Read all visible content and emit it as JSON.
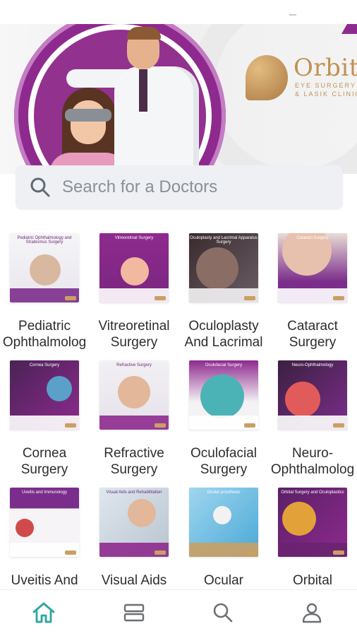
{
  "app": {
    "banner": {
      "logo_name": "Orbit",
      "logo_sub1": "EYE SURGERY",
      "logo_sub2": "& LASIK CLINICS"
    },
    "search": {
      "placeholder": "Search for a Doctors",
      "icon": "search-icon"
    },
    "specialties": [
      {
        "label": "Pediatric\nOphthalmolog",
        "thumb_title": "Pediatric Ophthalmology and Strabismus Surgery",
        "accent": "#7b2d8b"
      },
      {
        "label": "Vitreoretinal\nSurgery",
        "thumb_title": "Vitreoretinal Surgery",
        "accent": "#8e2a8e"
      },
      {
        "label": "Oculoplasty\nAnd Lacrimal",
        "thumb_title": "Oculoplasty and Lacrimal Apparatus Surgery",
        "accent": "#6a2470"
      },
      {
        "label": "Cataract\nSurgery",
        "thumb_title": "Cataract Surgery",
        "accent": "#7b2d8b"
      },
      {
        "label": "Cornea\nSurgery",
        "thumb_title": "Cornea Surgery",
        "accent": "#6b2a7a"
      },
      {
        "label": "Refractive\nSurgery",
        "thumb_title": "Refractive Surgery",
        "accent": "#8e2a8e"
      },
      {
        "label": "Oculofacial\nSurgery",
        "thumb_title": "Oculofacial Surgery",
        "accent": "#7b2d8b"
      },
      {
        "label": "Neuro-\nOphthalmolog",
        "thumb_title": "Neuro-Ophthalmology",
        "accent": "#6a2470"
      },
      {
        "label": "Uveitis And",
        "thumb_title": "Uveitis and Immunology",
        "accent": "#7b2d8b"
      },
      {
        "label": "Visual Aids",
        "thumb_title": "Visual Aids and Rehabilitation",
        "accent": "#8e2a8e"
      },
      {
        "label": "Ocular",
        "thumb_title": "Ocular prosthesis",
        "accent": "#c9a064"
      },
      {
        "label": "Orbital",
        "thumb_title": "Orbital Surgery and Oculoplastics",
        "accent": "#6a2470"
      }
    ],
    "bottom_nav": [
      {
        "name": "home",
        "icon": "home-icon",
        "active": true
      },
      {
        "name": "list",
        "icon": "list-icon",
        "active": false
      },
      {
        "name": "search",
        "icon": "search-icon",
        "active": false
      },
      {
        "name": "profile",
        "icon": "user-icon",
        "active": false
      }
    ],
    "colors": {
      "brand_purple": "#8e2a8e",
      "accent_teal": "#2aa6a0",
      "nav_gray": "#6b6f73",
      "gold": "#c39050"
    }
  }
}
